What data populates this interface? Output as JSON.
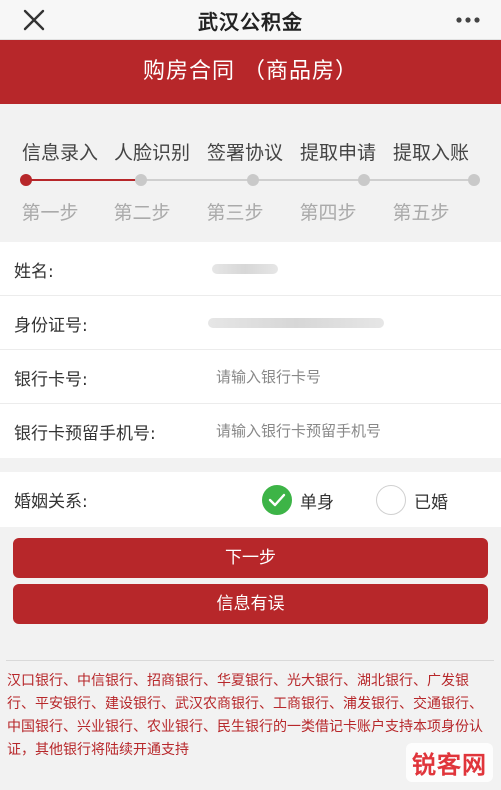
{
  "topbar": {
    "title": "武汉公积金",
    "close_icon": "close-icon",
    "more_icon": "more-dots-icon"
  },
  "banner": {
    "title": "购房合同 （商品房）"
  },
  "steps": {
    "items": [
      {
        "label": "信息录入",
        "sub": "第一步",
        "active": true
      },
      {
        "label": "人脸识别",
        "sub": "第二步",
        "active": false
      },
      {
        "label": "签署协议",
        "sub": "第三步",
        "active": false
      },
      {
        "label": "提取申请",
        "sub": "第四步",
        "active": false
      },
      {
        "label": "提取入账",
        "sub": "第五步",
        "active": false
      }
    ]
  },
  "form": {
    "name_label": "姓名:",
    "id_label": "身份证号:",
    "card_label": "银行卡号:",
    "card_placeholder": "请输入银行卡号",
    "phone_label": "银行卡预留手机号:",
    "phone_placeholder": "请输入银行卡预留手机号"
  },
  "marital": {
    "label": "婚姻关系:",
    "options": [
      {
        "label": "单身",
        "checked": true
      },
      {
        "label": "已婚",
        "checked": false
      }
    ]
  },
  "buttons": {
    "next": "下一步",
    "error": "信息有误"
  },
  "notice": "汉口银行、中信银行、招商银行、华夏银行、光大银行、湖北银行、广发银行、平安银行、建设银行、武汉农商银行、工商银行、浦发银行、交通银行、中国银行、兴业银行、农业银行、民生银行的一类借记卡账户支持本项身份认证，其他银行将陆续开通支持",
  "watermark": "锐客网",
  "colors": {
    "brand": "#b7272a",
    "check": "#3db447",
    "watermark": "#e0353b"
  }
}
